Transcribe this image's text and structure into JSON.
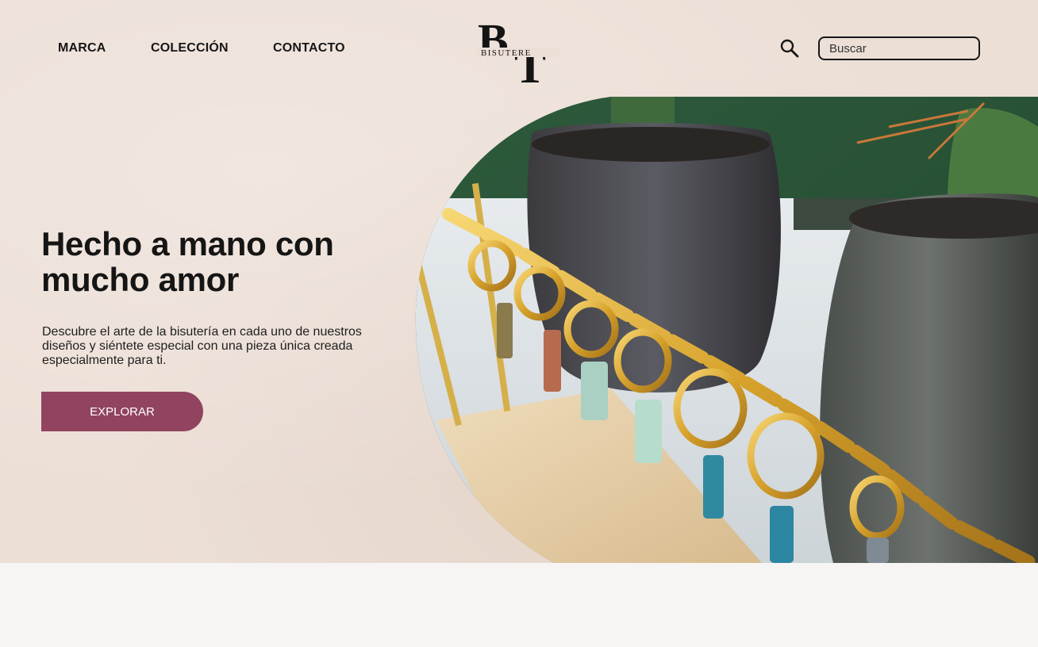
{
  "nav": {
    "items": [
      {
        "label": "MARCA"
      },
      {
        "label": "COLECCIÓN"
      },
      {
        "label": "CONTACTO"
      }
    ]
  },
  "brand": {
    "monogram": "BT",
    "name": "BISUTERE"
  },
  "search": {
    "placeholder": "Buscar",
    "icon": "search-icon"
  },
  "hero": {
    "headline": "Hecho a mano con mucho amor",
    "description": "Descubre el arte de la bisutería en cada uno de nuestros diseños y siéntete especial con una pieza única creada especialmente para ti.",
    "cta_label": "EXPLORAR",
    "image": "gold-hoop-earrings-on-stand-with-cacti"
  },
  "colors": {
    "background": "#ecdfd6",
    "cta": "#914360",
    "text": "#151515"
  }
}
